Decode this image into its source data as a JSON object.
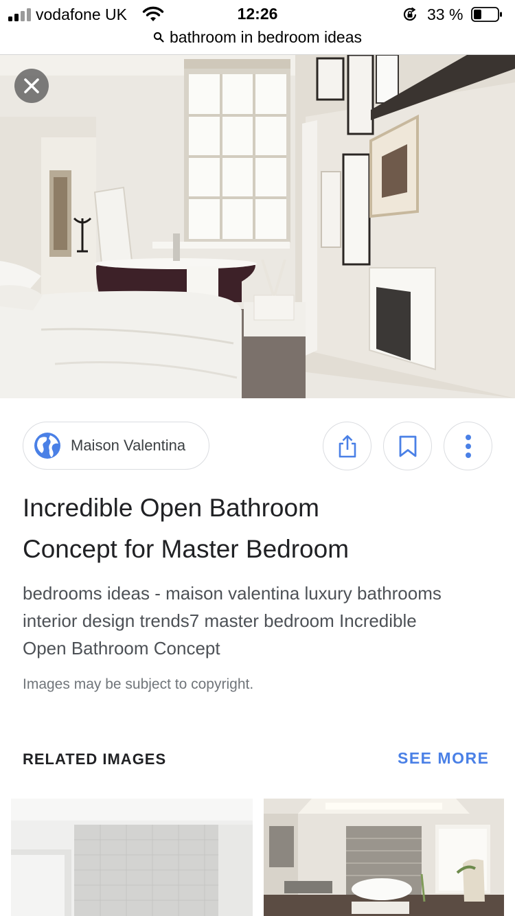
{
  "status_bar": {
    "carrier": "vodafone UK",
    "time": "12:26",
    "battery_percent": "33 %",
    "battery_level": 0.33
  },
  "url_bar": {
    "query": "bathroom in bedroom ideas"
  },
  "result": {
    "source": "Maison Valentina",
    "title_line1": "Incredible Open Bathroom",
    "title_line2": "Concept for Master Bedroom",
    "description_line1": "bedrooms ideas - maison valentina luxury bathrooms",
    "description_line2": "interior design trends7 master bedroom Incredible",
    "description_line3": "Open Bathroom Concept",
    "copyright_notice": "Images may be subject to copyright."
  },
  "related": {
    "heading": "RELATED IMAGES",
    "see_more_label": "SEE MORE"
  },
  "colors": {
    "accent_blue": "#4a80e6",
    "chip_border": "#dadce0"
  },
  "icons": {
    "close": "close-icon",
    "globe": "globe-icon",
    "share": "share-icon",
    "bookmark": "bookmark-icon",
    "more": "more-vertical-icon",
    "search": "search-icon"
  }
}
